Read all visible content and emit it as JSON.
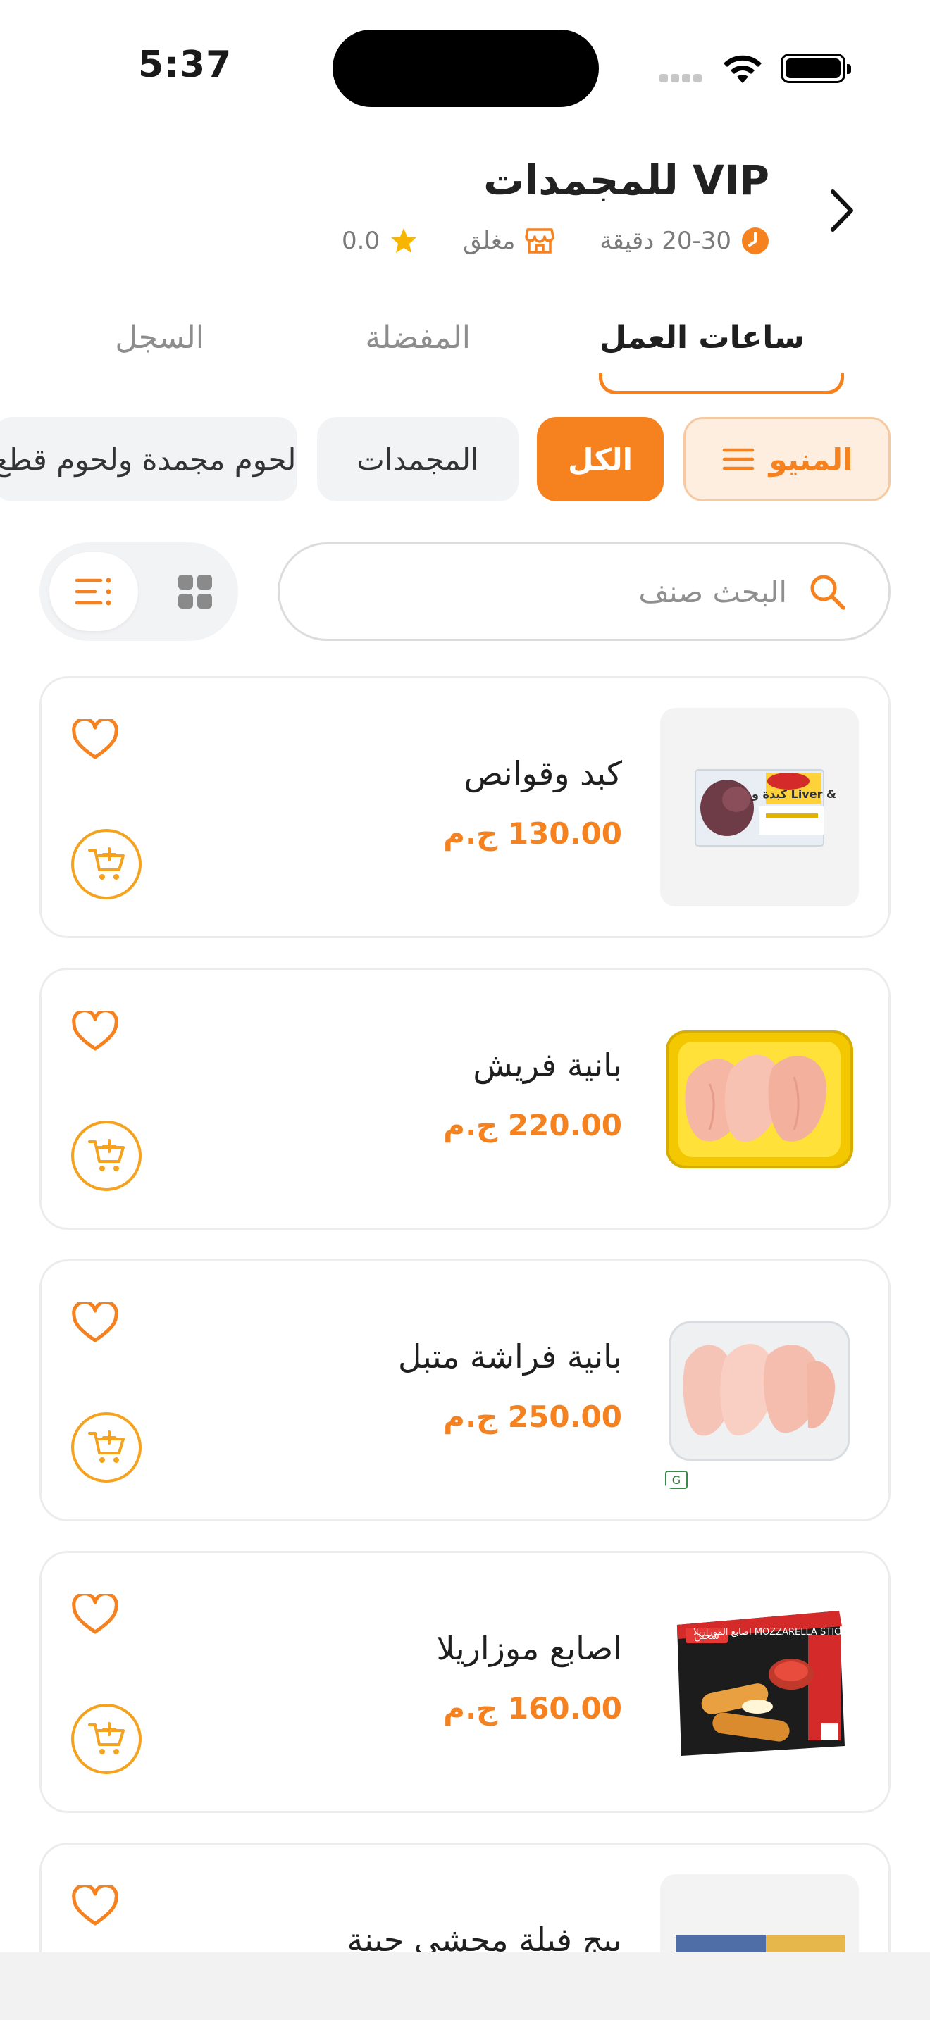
{
  "status_bar": {
    "time": "5:37"
  },
  "header": {
    "title": "VIP للمجمدات",
    "delivery_time": "20-30 دقيقة",
    "store_status": "مغلق",
    "rating": "0.0"
  },
  "tabs": [
    {
      "label": "ساعات العمل",
      "active": true
    },
    {
      "label": "المفضلة",
      "active": false
    },
    {
      "label": "السجل",
      "active": false
    }
  ],
  "chips": {
    "menu": "المنيو",
    "all": "الكل",
    "frozen": "المجمدات",
    "meat": "لحوم مجمدة ولحوم قطع"
  },
  "search": {
    "placeholder": "البحث صنف"
  },
  "products": [
    {
      "name": "كبد وقوانص",
      "price": "130.00 ج.م"
    },
    {
      "name": "بانية فريش",
      "price": "220.00 ج.م"
    },
    {
      "name": "بانية فراشة متبل",
      "price": "250.00 ج.م"
    },
    {
      "name": "اصابع موزاريلا",
      "price": "160.00 ج.م"
    },
    {
      "name": "بيج فيلة محشي جبنة",
      "price": ""
    }
  ],
  "product_image_labels": {
    "liver_pack": "كبدة و Liver &",
    "mozzarella_box": "اصابع الموزاريلا MOZZARELLA STICKS",
    "brand": "سحين"
  },
  "colors": {
    "accent": "#f5821f",
    "cart": "#f5a21f",
    "star": "#f7b500"
  }
}
